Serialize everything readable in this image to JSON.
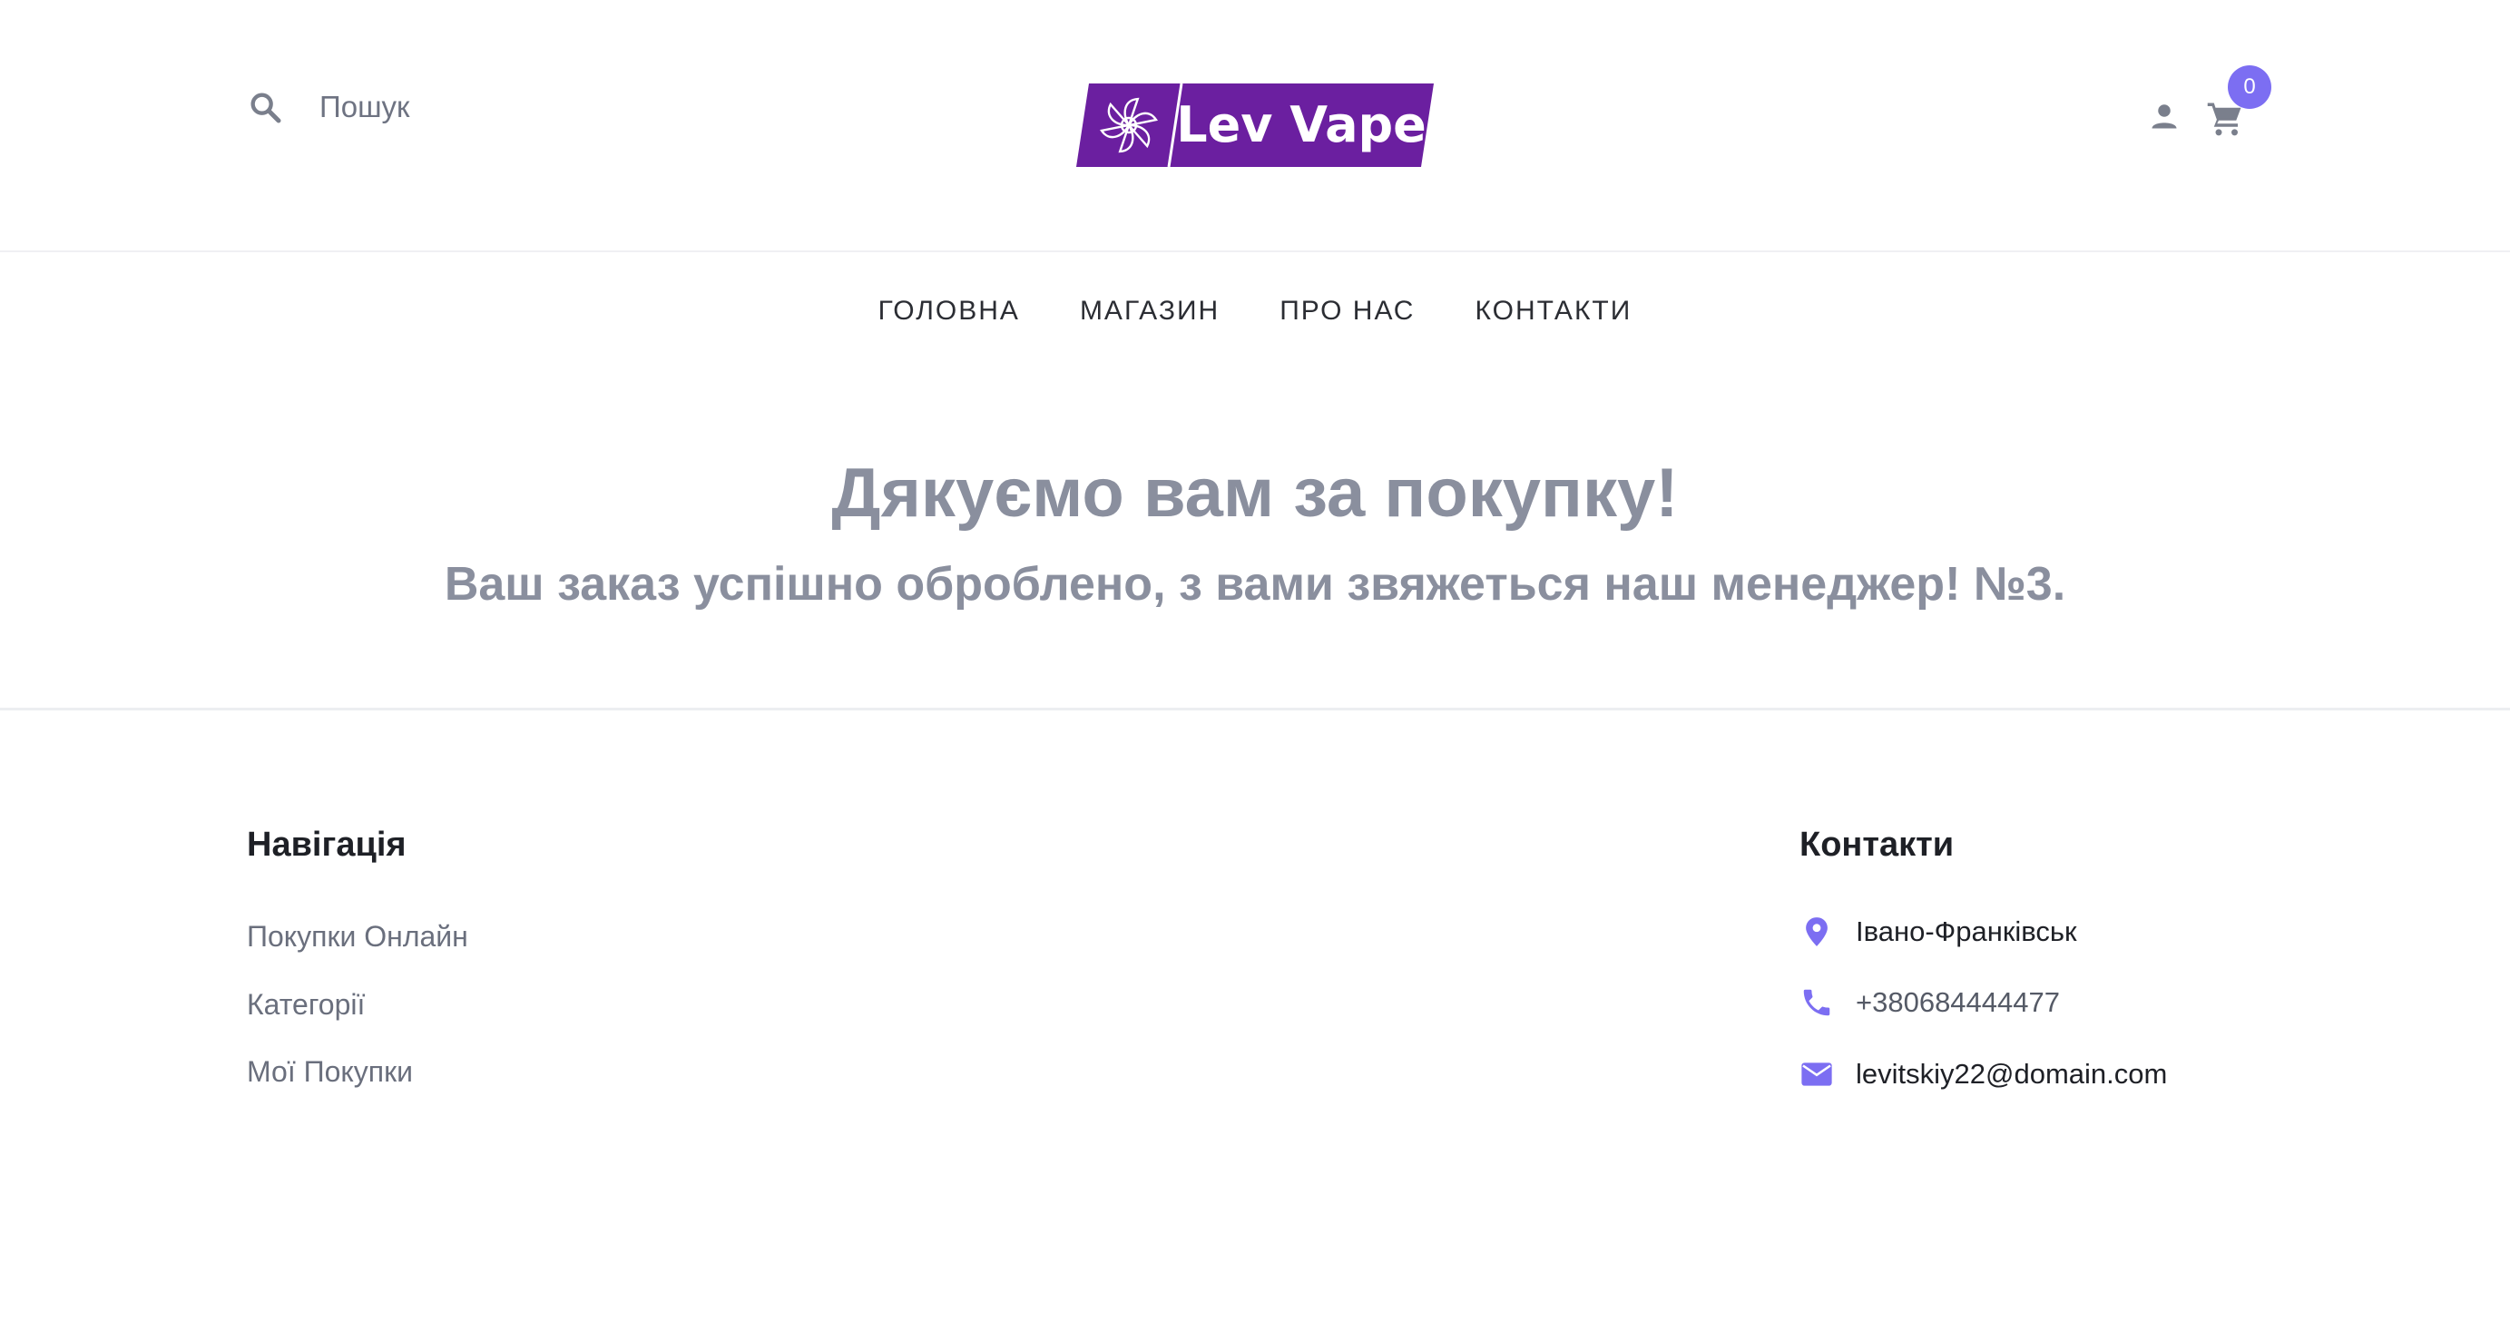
{
  "header": {
    "search_label": "Пошук",
    "logo_text": "Lev Vape",
    "cart_count": "0"
  },
  "nav": {
    "items": [
      "ГОЛОВНА",
      "МАГАЗИН",
      "ПРО НАС",
      "КОНТАКТИ"
    ]
  },
  "main": {
    "title": "Дякуємо вам за покупку!",
    "message": "Ваш заказ успішно оброблено, з вами звяжеться наш менеджер!",
    "order_number": "№3",
    "order_suffix": "."
  },
  "footer": {
    "navigation": {
      "title": "Навігація",
      "links": [
        "Покупки Онлайн",
        "Категорії",
        "Мої Покупки"
      ]
    },
    "contacts": {
      "title": "Контакти",
      "city": "Івано-Франківськ",
      "phone": "+380684444477",
      "email": "levitskiy22@domain.com"
    }
  },
  "colors": {
    "brand_purple": "#6b1fa0",
    "accent": "#7c6ef2",
    "heading_gray": "#8a8f9e",
    "icon_gray": "#7a7f8c"
  },
  "icons": [
    "search-icon",
    "logo-flower-icon",
    "user-icon",
    "cart-icon",
    "location-pin-icon",
    "phone-icon",
    "email-icon"
  ]
}
